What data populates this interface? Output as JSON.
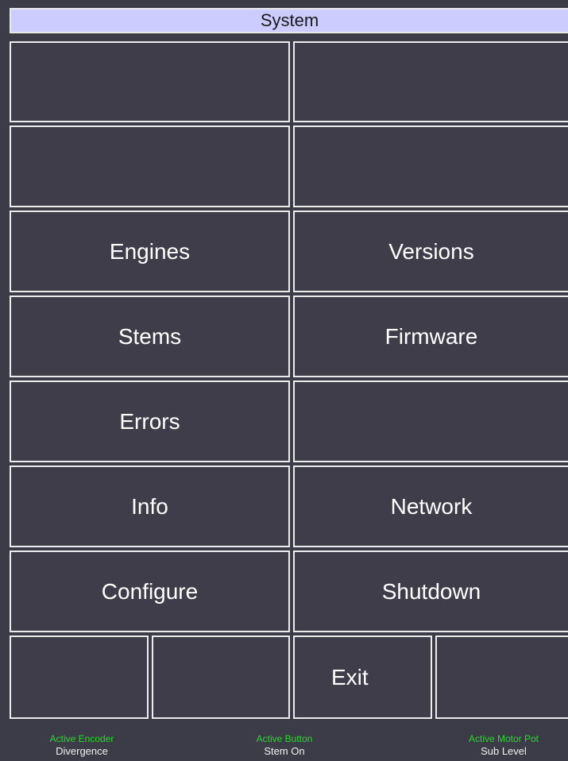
{
  "title": "System",
  "colors": {
    "background": "#3c3c48",
    "button_fill": "#3f3d4a",
    "button_border": "#ececec",
    "title_bar": "#ccccff",
    "status_label": "#22dd22"
  },
  "grid": {
    "row1": {
      "left": "",
      "right": ""
    },
    "row2": {
      "left": "",
      "right": ""
    },
    "row3": {
      "left": "Engines",
      "right": "Versions"
    },
    "row4": {
      "left": "Stems",
      "right": "Firmware"
    },
    "row5": {
      "left": "Errors",
      "right": ""
    },
    "row6": {
      "left": "Info",
      "right": "Network"
    },
    "row7": {
      "left": "Configure",
      "right": "Shutdown"
    }
  },
  "bottom_row": [
    "",
    "",
    "Exit",
    ""
  ],
  "status_bar": {
    "encoder": {
      "label": "Active Encoder",
      "value": "Divergence"
    },
    "button": {
      "label": "Active Button",
      "value": "Stem On"
    },
    "motor_pot": {
      "label": "Active Motor Pot",
      "value": "Sub Level"
    }
  }
}
